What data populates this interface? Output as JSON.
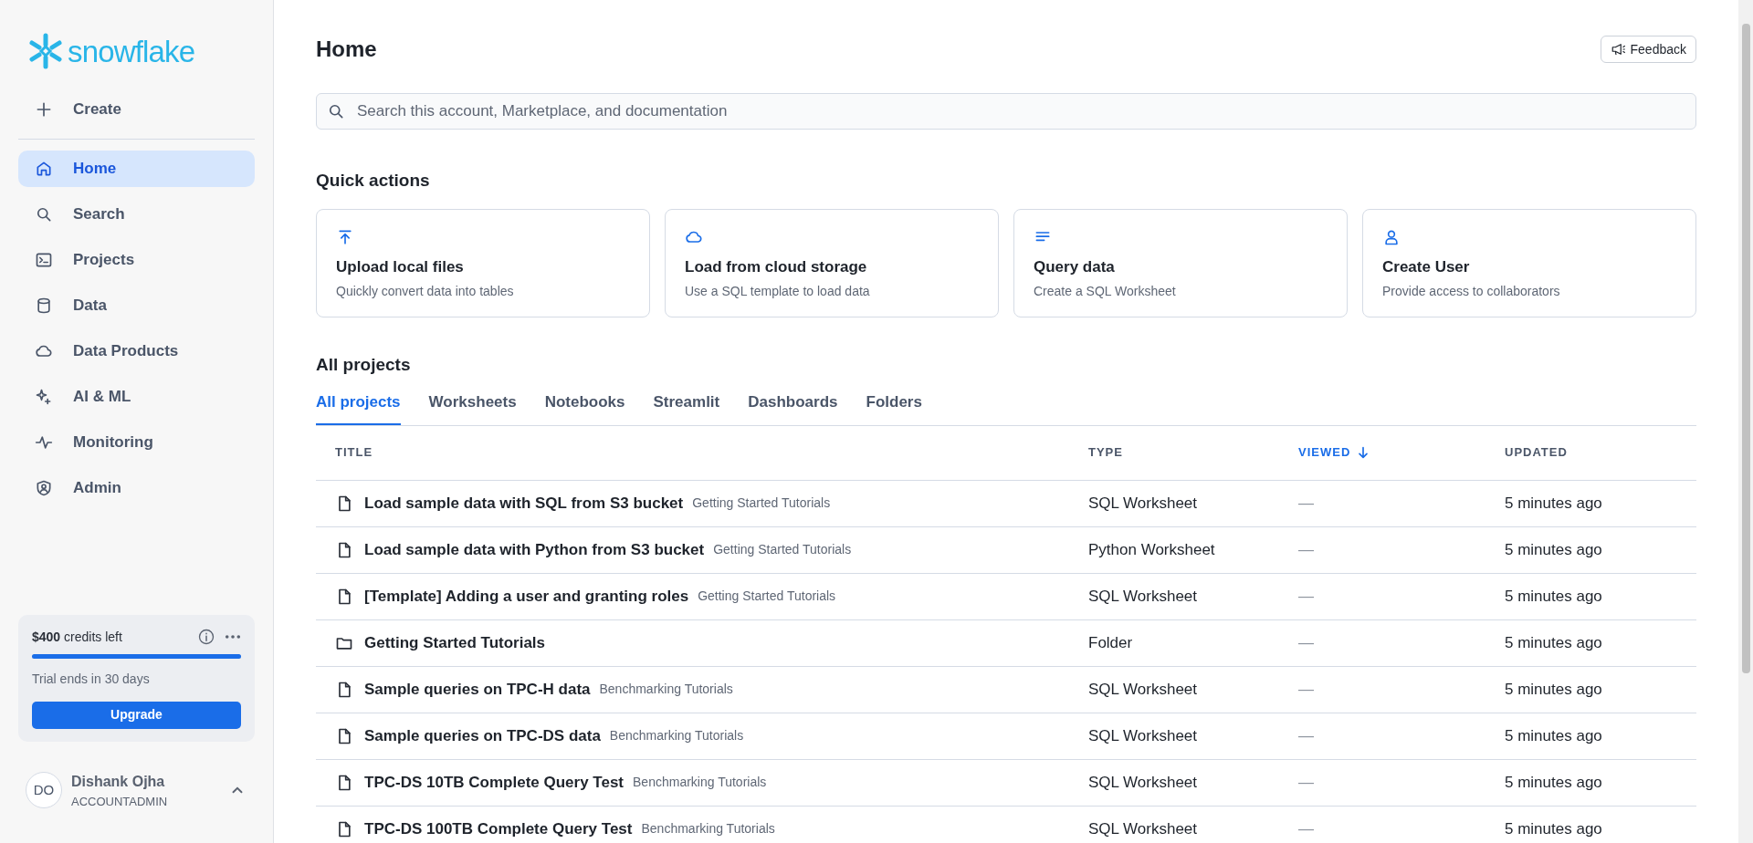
{
  "sidebar": {
    "logo": "snowflake",
    "create": "Create",
    "items": [
      {
        "label": "Home",
        "kind": "home",
        "selected": true
      },
      {
        "label": "Search",
        "kind": "search",
        "selected": false
      },
      {
        "label": "Projects",
        "kind": "terminal",
        "selected": false
      },
      {
        "label": "Data",
        "kind": "database",
        "selected": false
      },
      {
        "label": "Data Products",
        "kind": "cloud",
        "selected": false
      },
      {
        "label": "AI & ML",
        "kind": "sparkle",
        "selected": false
      },
      {
        "label": "Monitoring",
        "kind": "pulse",
        "selected": false
      },
      {
        "label": "Admin",
        "kind": "shield",
        "selected": false
      }
    ],
    "credits": {
      "amount": "$400",
      "text": "credits left",
      "level": 1,
      "trial": "Trial ends in 30 days",
      "button": "Upgrade"
    },
    "user": {
      "initials": "DO",
      "name": "Dishank Ojha",
      "role": "ACCOUNTADMIN"
    }
  },
  "header": {
    "title": "Home",
    "feedback": "Feedback"
  },
  "search": {
    "placeholder": "Search this account, Marketplace, and documentation"
  },
  "quick_actions": {
    "title": "Quick actions",
    "cards": [
      {
        "kind": "upload",
        "title": "Upload local files",
        "subtitle": "Quickly convert data into tables"
      },
      {
        "kind": "cloud",
        "title": "Load from cloud storage",
        "subtitle": "Use a SQL template to load data"
      },
      {
        "kind": "lines",
        "title": "Query data",
        "subtitle": "Create a SQL Worksheet"
      },
      {
        "kind": "user",
        "title": "Create User",
        "subtitle": "Provide access to collaborators"
      }
    ]
  },
  "projects": {
    "title": "All projects",
    "tabs": [
      {
        "label": "All projects",
        "selected": true
      },
      {
        "label": "Worksheets",
        "selected": false
      },
      {
        "label": "Notebooks",
        "selected": false
      },
      {
        "label": "Streamlit",
        "selected": false
      },
      {
        "label": "Dashboards",
        "selected": false
      },
      {
        "label": "Folders",
        "selected": false
      }
    ],
    "table": {
      "columns": [
        {
          "label": "TITLE",
          "sorted": false
        },
        {
          "label": "TYPE",
          "sorted": false
        },
        {
          "label": "VIEWED",
          "sorted": true
        },
        {
          "label": "UPDATED",
          "sorted": false
        }
      ],
      "rows": [
        {
          "kind": "file",
          "title": "Load sample data with SQL from S3 bucket",
          "folder": "Getting Started Tutorials",
          "type": "SQL Worksheet",
          "viewed": "—",
          "updated": "5 minutes ago"
        },
        {
          "kind": "file",
          "title": "Load sample data with Python from S3 bucket",
          "folder": "Getting Started Tutorials",
          "type": "Python Worksheet",
          "viewed": "—",
          "updated": "5 minutes ago"
        },
        {
          "kind": "file",
          "title": "[Template] Adding a user and granting roles",
          "folder": "Getting Started Tutorials",
          "type": "SQL Worksheet",
          "viewed": "—",
          "updated": "5 minutes ago"
        },
        {
          "kind": "folder",
          "title": "Getting Started Tutorials",
          "type": "Folder",
          "viewed": "—",
          "updated": "5 minutes ago"
        },
        {
          "kind": "file",
          "title": "Sample queries on TPC-H data",
          "folder": "Benchmarking Tutorials",
          "type": "SQL Worksheet",
          "viewed": "—",
          "updated": "5 minutes ago"
        },
        {
          "kind": "file",
          "title": "Sample queries on TPC-DS data",
          "folder": "Benchmarking Tutorials",
          "type": "SQL Worksheet",
          "viewed": "—",
          "updated": "5 minutes ago"
        },
        {
          "kind": "file",
          "title": "TPC-DS 10TB Complete Query Test",
          "folder": "Benchmarking Tutorials",
          "type": "SQL Worksheet",
          "viewed": "—",
          "updated": "5 minutes ago"
        },
        {
          "kind": "file",
          "title": "TPC-DS 100TB Complete Query Test",
          "folder": "Benchmarking Tutorials",
          "type": "SQL Worksheet",
          "viewed": "—",
          "updated": "5 minutes ago"
        }
      ]
    }
  }
}
